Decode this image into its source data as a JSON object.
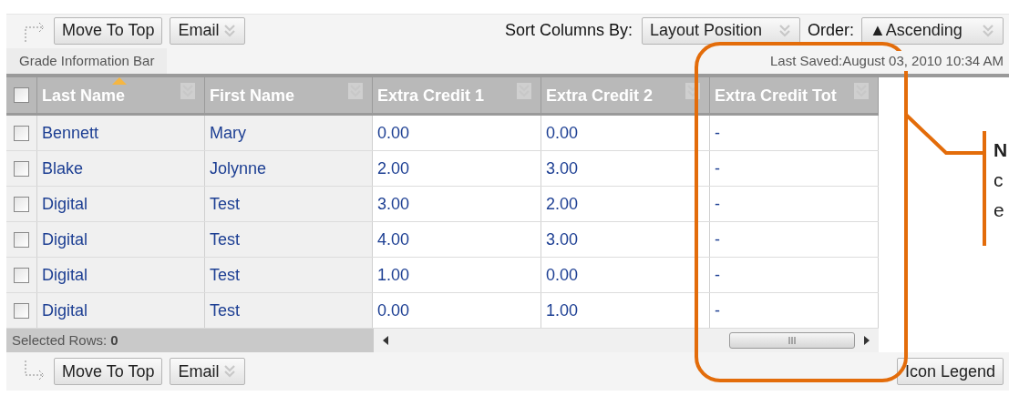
{
  "toolbar_top": {
    "buttons": [
      {
        "label": "Move To Top",
        "kind": "button"
      },
      {
        "label": "Email",
        "kind": "menu"
      }
    ],
    "sort_label": "Sort Columns By:",
    "sort_value": "Layout Position",
    "order_label": "Order:",
    "order_value": "▲Ascending"
  },
  "info_bar": {
    "tab": "Grade Information Bar",
    "last_saved": "Last Saved:August 03, 2010 10:34 AM"
  },
  "table": {
    "select_all_checked": false,
    "columns": [
      {
        "label": "Last Name",
        "sorted": true
      },
      {
        "label": "First Name",
        "sorted": false
      },
      {
        "label": "Extra Credit 1",
        "sorted": false
      },
      {
        "label": "Extra Credit 2",
        "sorted": false
      },
      {
        "label": "Extra Credit Tot",
        "sorted": false
      }
    ],
    "rows": [
      {
        "checked": false,
        "cells": [
          "Bennett",
          "Mary",
          "0.00",
          "0.00",
          "-"
        ]
      },
      {
        "checked": false,
        "cells": [
          "Blake",
          "Jolynne",
          "2.00",
          "3.00",
          "-"
        ]
      },
      {
        "checked": false,
        "cells": [
          "Digital",
          "Test",
          "3.00",
          "2.00",
          "-"
        ]
      },
      {
        "checked": false,
        "cells": [
          "Digital",
          "Test",
          "4.00",
          "3.00",
          "-"
        ]
      },
      {
        "checked": false,
        "cells": [
          "Digital",
          "Test",
          "1.00",
          "0.00",
          "-"
        ]
      },
      {
        "checked": false,
        "cells": [
          "Digital",
          "Test",
          "0.00",
          "1.00",
          "-"
        ]
      }
    ]
  },
  "status_bar": {
    "label": "Selected Rows:",
    "count": "0"
  },
  "toolbar_bottom": {
    "buttons": [
      {
        "label": "Move To Top",
        "kind": "button"
      },
      {
        "label": "Email",
        "kind": "menu"
      }
    ],
    "legend_button": "Icon Legend"
  },
  "callout": {
    "lines": [
      {
        "text": "N",
        "bold": true
      },
      {
        "text": "c",
        "bold": false
      },
      {
        "text": "e",
        "bold": false
      }
    ]
  }
}
